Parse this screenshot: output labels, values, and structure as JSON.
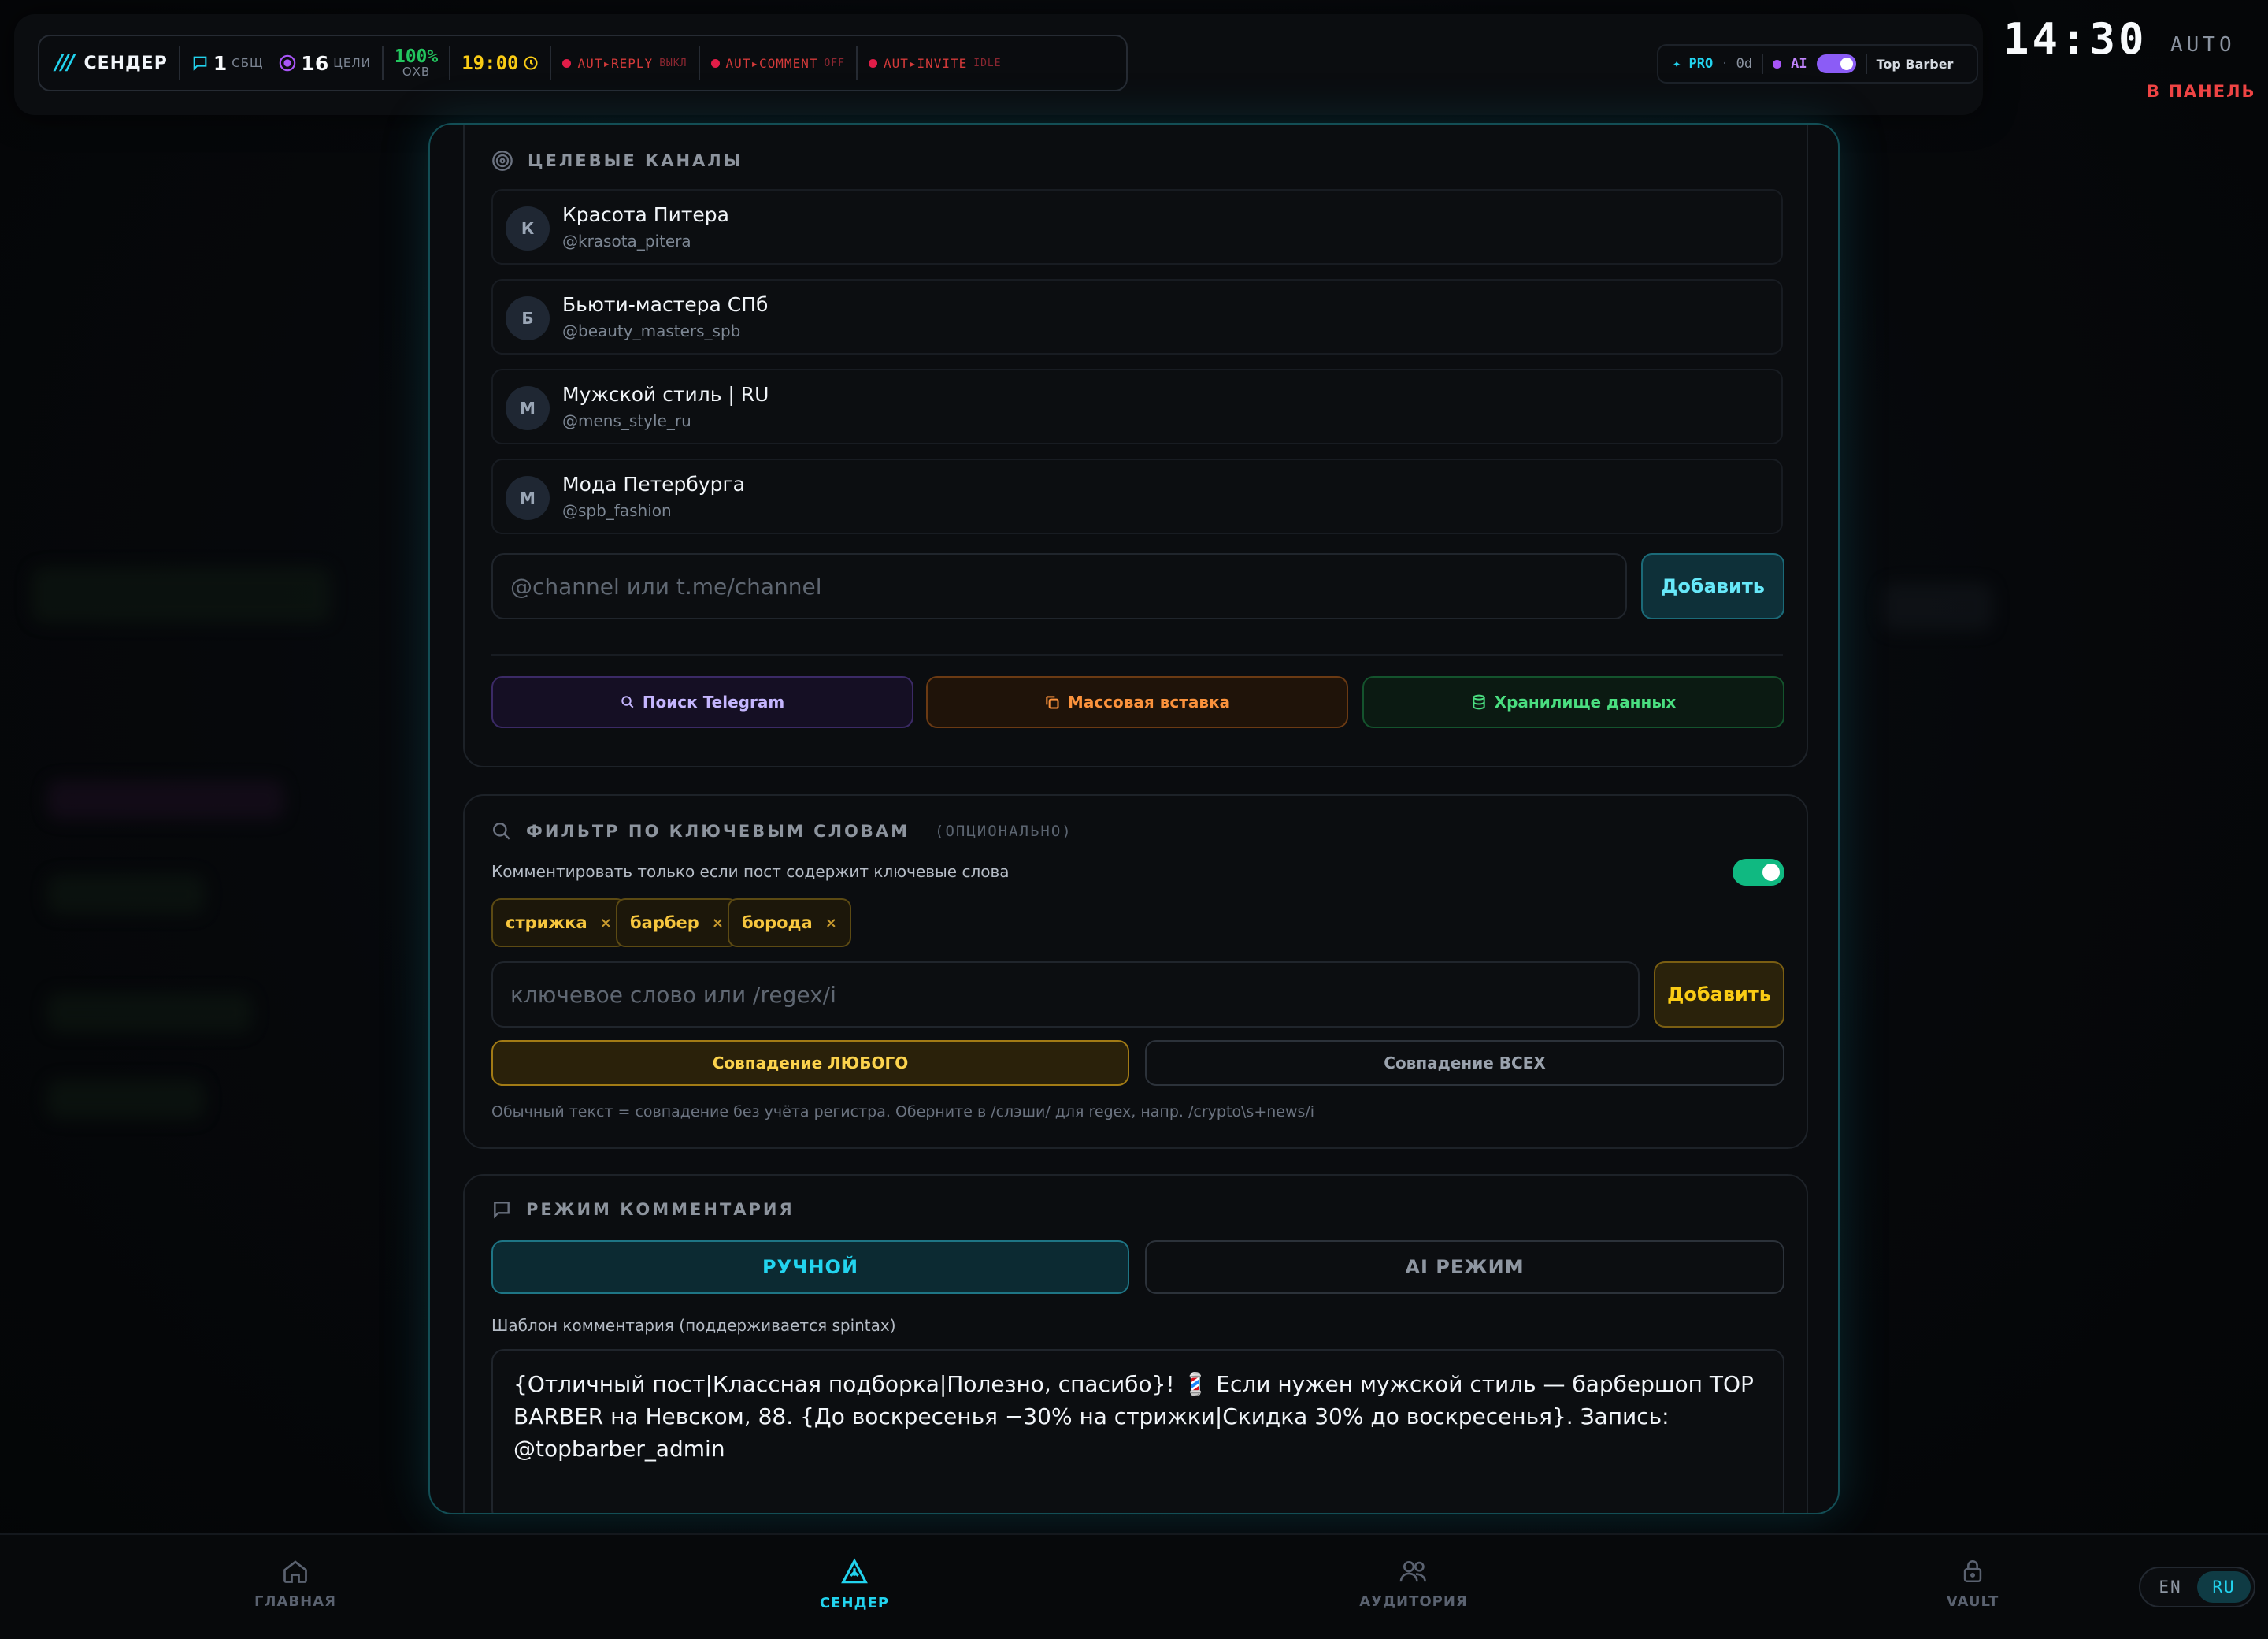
{
  "status_bar": {
    "app_name": "СЕНДЕР",
    "messages_count": "1",
    "messages_label": "СБЩ",
    "targets_count": "16",
    "targets_label": "ЦЕЛИ",
    "coverage_value": "100%",
    "coverage_label": "ОХВ",
    "time_value": "19:00",
    "auto_reply": {
      "label": "AUT▸REPLY",
      "state": "ВЫКЛ"
    },
    "auto_comment": {
      "label": "AUT▸COMMENT",
      "state": "OFF"
    },
    "auto_invite": {
      "label": "AUT▸INVITE",
      "state": "IDLE"
    }
  },
  "pro_bar": {
    "pro_label": "✦ PRO",
    "pro_days": "0d",
    "ai_label": "AI",
    "ai_enabled": true,
    "account_name": "Top Barber"
  },
  "clock": "14:30",
  "mode_label": "AUTO",
  "panel_link": "В ПАНЕЛЬ",
  "channels_section": {
    "title": "ЦЕЛЕВЫЕ КАНАЛЫ",
    "channels": [
      {
        "initial": "К",
        "name": "Красота Питера",
        "handle": "@krasota_pitera"
      },
      {
        "initial": "Б",
        "name": "Бьюти-мастера СПб",
        "handle": "@beauty_masters_spb"
      },
      {
        "initial": "М",
        "name": "Мужской стиль | RU",
        "handle": "@mens_style_ru"
      },
      {
        "initial": "М",
        "name": "Мода Петербурга",
        "handle": "@spb_fashion"
      }
    ],
    "input_placeholder": "@channel или t.me/channel",
    "add_button": "Добавить",
    "search_button": "Поиск Telegram",
    "bulk_button": "Массовая вставка",
    "storage_button": "Хранилище данных"
  },
  "keyword_section": {
    "title": "ФИЛЬТР ПО КЛЮЧЕВЫМ СЛОВАМ",
    "optional_label": "(ОПЦИОНАЛЬНО)",
    "toggle_label": "Комментировать только если пост содержит ключевые слова",
    "toggle_on": true,
    "tags": [
      "стрижка",
      "барбер",
      "борода"
    ],
    "input_placeholder": "ключевое слово или /regex/i",
    "add_button": "Добавить",
    "match_any": "Совпадение ЛЮБОГО",
    "match_all": "Совпадение ВСЕХ",
    "hint": "Обычный текст = совпадение без учёта регистра. Оберните в /слэши/ для regex, напр. /crypto\\s+news/i"
  },
  "comment_section": {
    "title": "РЕЖИМ КОММЕНТАРИЯ",
    "manual_tab": "РУЧНОЙ",
    "ai_tab": "AI РЕЖИМ",
    "template_label": "Шаблон комментария (поддерживается spintax)",
    "template_text": "{Отличный пост|Классная подборка|Полезно, спасибо}! 💈 Если нужен мужской стиль — барбершоп TOP BARBER на Невском, 88. {До воскресенья −30% на стрижки|Скидка 30% до воскресенья}. Запись: @topbarber_admin"
  },
  "bottom_nav": {
    "items": [
      {
        "label": "ГЛАВНАЯ",
        "icon": "home-icon"
      },
      {
        "label": "СЕНДЕР",
        "icon": "triangle-icon"
      },
      {
        "label": "АУДИТОРИЯ",
        "icon": "users-icon"
      },
      {
        "label": "VAULT",
        "icon": "lock-icon"
      }
    ],
    "active": "СЕНДЕР"
  },
  "language": {
    "options": [
      "EN",
      "RU"
    ],
    "active": "RU"
  },
  "colors": {
    "accent": "#22d3ee",
    "danger": "#ef4444",
    "success": "#10b981",
    "warning": "#f6c63e",
    "purple": "#a855f7"
  }
}
